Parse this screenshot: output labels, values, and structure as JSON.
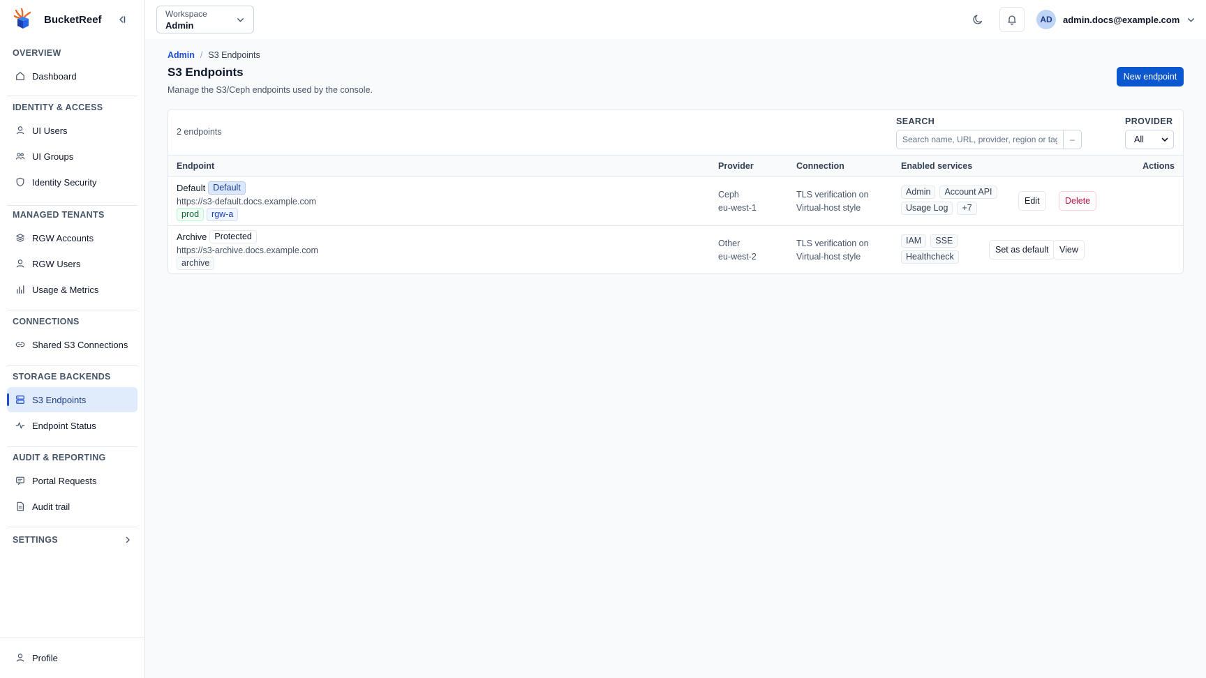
{
  "app": {
    "name": "BucketReef"
  },
  "sidebar": {
    "sections": [
      {
        "title": "OVERVIEW",
        "items": [
          {
            "label": "Dashboard",
            "icon": "home-icon"
          }
        ]
      },
      {
        "title": "IDENTITY & ACCESS",
        "items": [
          {
            "label": "UI Users",
            "icon": "user-icon"
          },
          {
            "label": "UI Groups",
            "icon": "users-icon"
          },
          {
            "label": "Identity Security",
            "icon": "shield-icon"
          }
        ]
      },
      {
        "title": "MANAGED TENANTS",
        "items": [
          {
            "label": "RGW Accounts",
            "icon": "layers-icon"
          },
          {
            "label": "RGW Users",
            "icon": "user-icon"
          },
          {
            "label": "Usage & Metrics",
            "icon": "bar-chart-icon"
          }
        ]
      },
      {
        "title": "CONNECTIONS",
        "items": [
          {
            "label": "Shared S3 Connections",
            "icon": "link-icon"
          }
        ]
      },
      {
        "title": "STORAGE BACKENDS",
        "items": [
          {
            "label": "S3 Endpoints",
            "icon": "server-icon",
            "active": true
          },
          {
            "label": "Endpoint Status",
            "icon": "activity-icon"
          }
        ]
      },
      {
        "title": "AUDIT & REPORTING",
        "items": [
          {
            "label": "Portal Requests",
            "icon": "message-icon"
          },
          {
            "label": "Audit trail",
            "icon": "file-icon"
          }
        ]
      }
    ],
    "settings_label": "SETTINGS",
    "profile_label": "Profile"
  },
  "header": {
    "workspace_label": "Workspace",
    "workspace_value": "Admin",
    "user_initials": "AD",
    "user_email": "admin.docs@example.com"
  },
  "page": {
    "breadcrumb_parent": "Admin",
    "breadcrumb_separator": "/",
    "breadcrumb_current": "S3 Endpoints",
    "title": "S3 Endpoints",
    "description": "Manage the S3/Ceph endpoints used by the console.",
    "new_button": "New endpoint"
  },
  "table": {
    "count_text": "2 endpoints",
    "search_label": "SEARCH",
    "search_placeholder": "Search name, URL, provider, region or tag",
    "search_clear": "–",
    "provider_label": "PROVIDER",
    "provider_value": "All",
    "columns": {
      "endpoint": "Endpoint",
      "provider": "Provider",
      "connection": "Connection",
      "services": "Enabled services",
      "actions": "Actions"
    },
    "rows": [
      {
        "name": "Default",
        "status_badge": "Default",
        "url": "https://s3-default.docs.example.com",
        "tags": [
          "prod",
          "rgw-a"
        ],
        "provider": "Ceph",
        "region": "eu-west-1",
        "tls": "TLS verification on",
        "style": "Virtual-host style",
        "services": [
          "Admin",
          "Account API",
          "Usage Log",
          "+7"
        ],
        "actions": [
          "Edit",
          "Delete"
        ]
      },
      {
        "name": "Archive",
        "status_badge": "Protected",
        "url": "https://s3-archive.docs.example.com",
        "tags": [
          "archive"
        ],
        "provider": "Other",
        "region": "eu-west-2",
        "tls": "TLS verification on",
        "style": "Virtual-host style",
        "services": [
          "IAM",
          "SSE",
          "Healthcheck"
        ],
        "actions": [
          "Set as default",
          "View"
        ]
      }
    ]
  },
  "colors": {
    "accent": "#0b57d0",
    "active_bg": "#e0ecfb",
    "danger": "#be123c"
  }
}
